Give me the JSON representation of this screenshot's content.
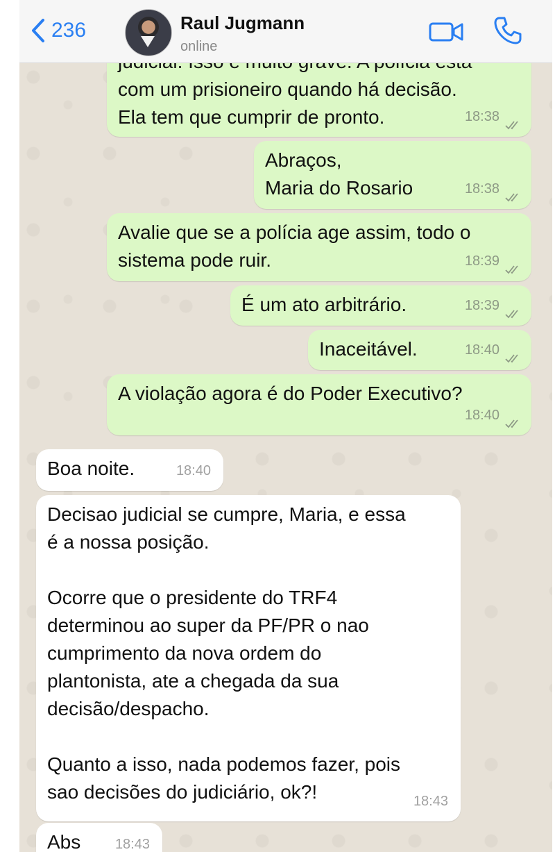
{
  "header": {
    "back_count": "236",
    "contact_name": "Raul Jugmann",
    "status": "online"
  },
  "messages": [
    {
      "text": "judicial. Isso é muito grave. A polícia está\ncom um prisioneiro quando há decisão.\nEla tem que cumprir de pronto.",
      "time": "18:38"
    },
    {
      "text": "Abraços,\nMaria do Rosario",
      "time": "18:38"
    },
    {
      "text": "Avalie que se a polícia age assim, todo o\nsistema pode ruir.",
      "time": "18:39"
    },
    {
      "text": "É um ato arbitrário.",
      "time": "18:39"
    },
    {
      "text": "Inaceitável.",
      "time": "18:40"
    },
    {
      "text": "A violação agora é do Poder Executivo?",
      "time": "18:40"
    },
    {
      "text": "Boa noite.",
      "time": "18:40"
    },
    {
      "text": "Decisao judicial se cumpre, Maria, e essa\né a nossa posição.\n\nOcorre que o presidente do TRF4\ndeterminou ao super da PF/PR o nao\ncumprimento da nova ordem do\nplantonista, ate a chegada da sua\ndecisão/despacho.\n\nQuanto a isso, nada podemos fazer, pois\nsao decisões do judiciário, ok?!",
      "time": "18:43"
    },
    {
      "text": "Abs",
      "time": "18:43"
    }
  ],
  "icons": {
    "back": "chevron-left-icon",
    "video": "video-camera-icon",
    "call": "phone-icon",
    "read": "double-check-icon"
  },
  "colors": {
    "accent": "#2a7ff2",
    "outgoing": "#dcf8c6",
    "incoming": "#ffffff",
    "wallpaper": "#e7e1d7"
  }
}
